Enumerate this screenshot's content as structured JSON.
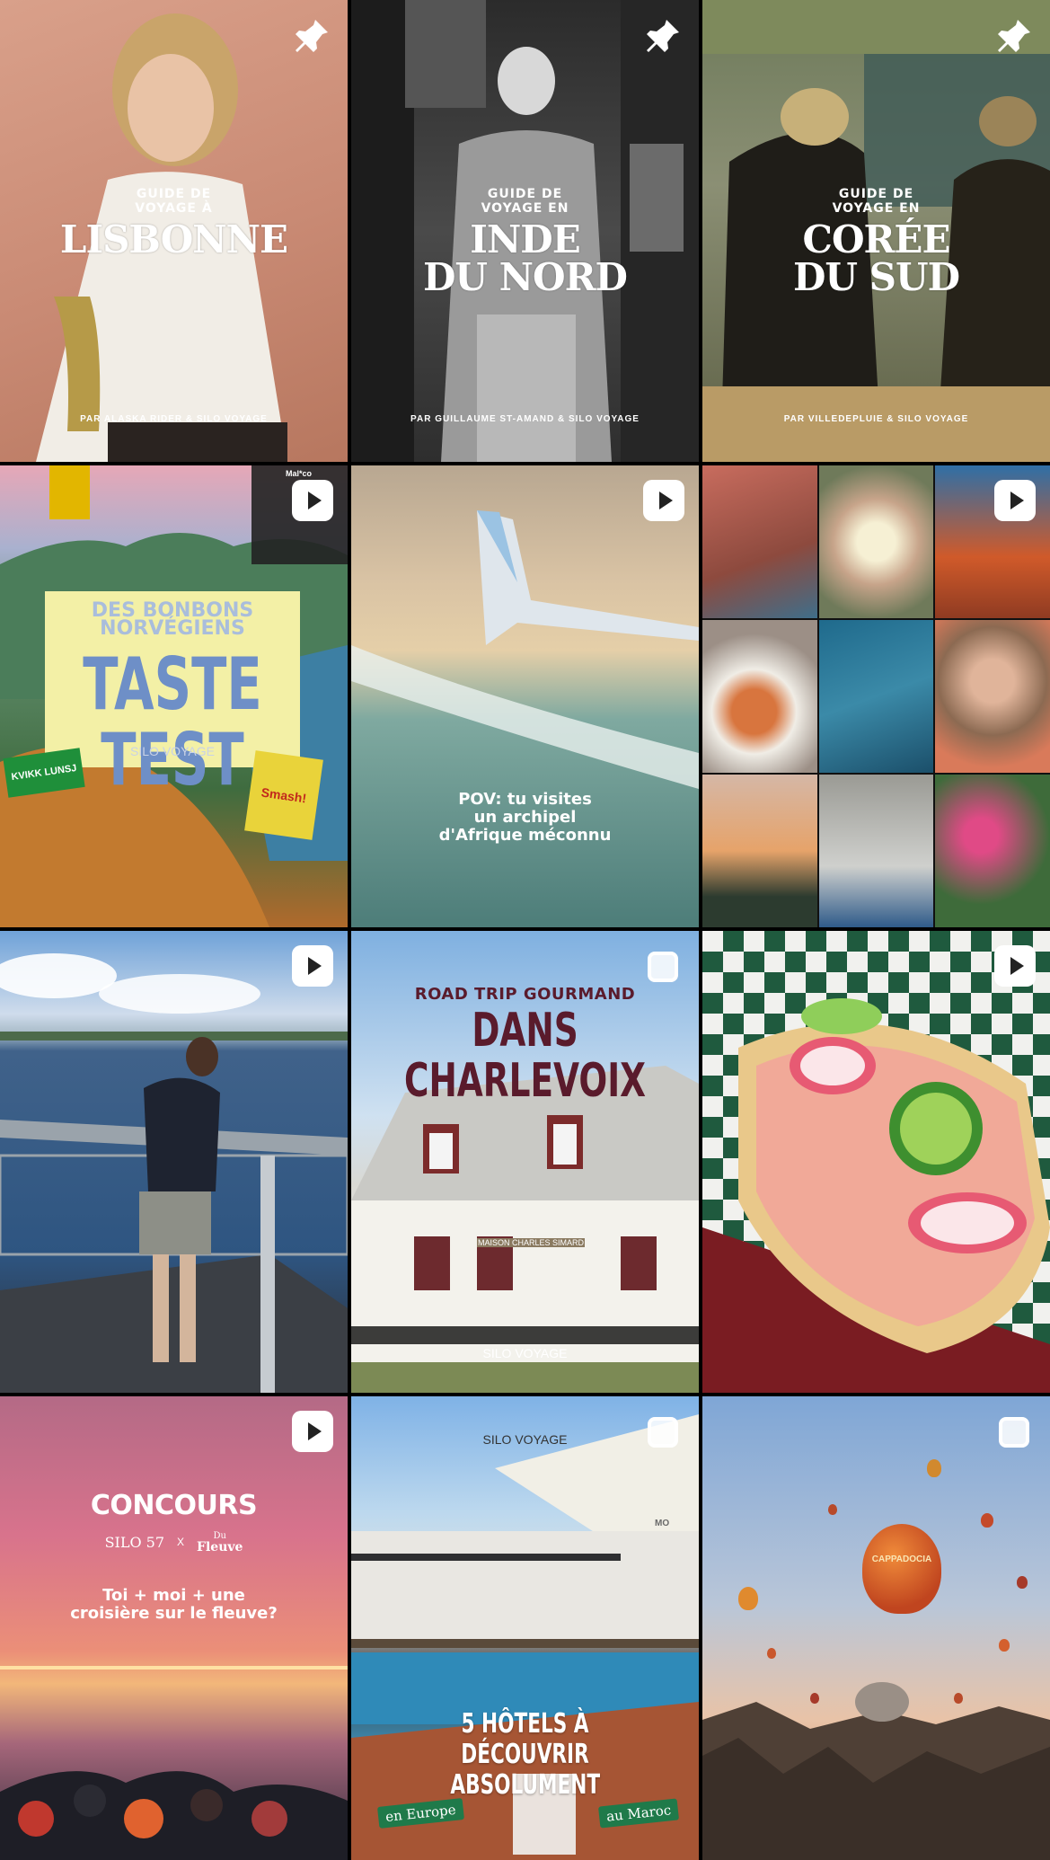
{
  "grid": {
    "tiles": [
      {
        "id": "lisbonne",
        "badge": "pin-icon",
        "line1": "GUIDE DE",
        "line2": "VOYAGE À",
        "title1": "LISBONNE",
        "title2": "",
        "byline": "PAR ALASKA RIDER & SILO VOYAGE"
      },
      {
        "id": "inde",
        "badge": "pin-icon",
        "line1": "GUIDE DE",
        "line2": "VOYAGE EN",
        "title1": "INDE",
        "title2": "DU NORD",
        "byline": "PAR GUILLAUME ST-AMAND & SILO VOYAGE"
      },
      {
        "id": "coree",
        "badge": "pin-icon",
        "line1": "GUIDE DE",
        "line2": "VOYAGE EN",
        "title1": "CORÉE",
        "title2": "DU SUD",
        "byline": "PAR VILLEDEPLUIE & SILO VOYAGE"
      },
      {
        "id": "taste",
        "badge": "reel-icon",
        "line1": "DES BONBONS",
        "line2": "NORVÉGIENS",
        "title1": "TASTE TEST",
        "footer": "SILO VOYAGE",
        "pack1": "KVIKK LUNSJ",
        "pack2": "Smash!",
        "pack3": "Mal*co"
      },
      {
        "id": "archipel",
        "badge": "reel-icon",
        "caption1": "POV: tu visites",
        "caption2": "un archipel",
        "caption3": "d'Afrique méconnu"
      },
      {
        "id": "collage",
        "badge": "reel-icon"
      },
      {
        "id": "lac",
        "badge": "reel-icon"
      },
      {
        "id": "charlevoix",
        "badge": "carousel-icon",
        "line1": "ROAD TRIP GOURMAND",
        "title1": "DANS CHARLEVOIX",
        "sign": "MAISON CHARLES SIMARD",
        "footer": "SILO VOYAGE"
      },
      {
        "id": "guedille",
        "badge": "reel-icon"
      },
      {
        "id": "concours",
        "badge": "reel-icon",
        "title1": "CONCOURS",
        "brand1": "SILO 57",
        "brand_x": "X",
        "brand2a": "Du",
        "brand2b": "Fleuve",
        "caption1": "Toi + moi + une",
        "caption2": "croisière sur le fleuve?"
      },
      {
        "id": "hotels",
        "badge": "carousel-icon",
        "header": "SILO VOYAGE",
        "title1": "5 HÔTELS À DÉCOUVRIR",
        "title2": "ABSOLUMENT",
        "tag1": "en Europe",
        "tag2": "au Maroc",
        "umbrella": "MO"
      },
      {
        "id": "cappadoce",
        "badge": "carousel-icon",
        "balloon_text": "CAPPADOCIA"
      }
    ]
  },
  "colors": {
    "taste_box": "#f3f0a6",
    "taste_text": "#6e8fc7",
    "charlevoix_text": "#5a1b2c",
    "badge_white": "#ffffff"
  }
}
